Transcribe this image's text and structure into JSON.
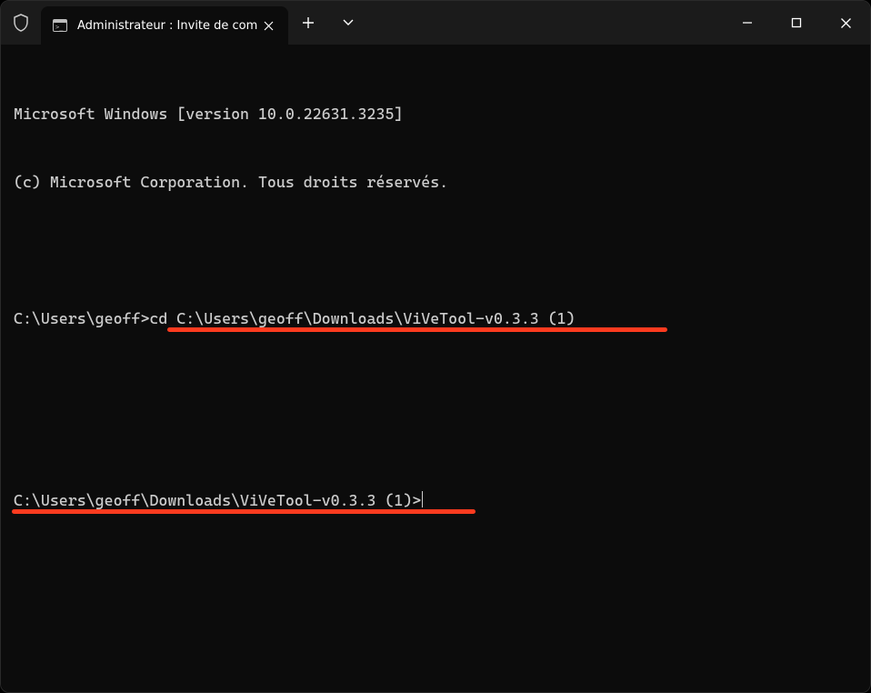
{
  "titlebar": {
    "tab_title": "Administrateur : Invite de com",
    "tab_icon": "cmd-icon"
  },
  "terminal": {
    "line1": "Microsoft Windows [version 10.0.22631.3235]",
    "line2": "(c) Microsoft Corporation. Tous droits réservés.",
    "prompt1_path": "C:\\Users\\geoff>",
    "prompt1_cmd": "cd C:\\Users\\geoff\\Downloads\\ViVeTool-v0.3.3 (1)",
    "prompt2_path": "C:\\Users\\geoff\\Downloads\\ViVeTool-v0.3.3 (1)>"
  },
  "annotations": {
    "underline_color": "#ff3b1f"
  }
}
